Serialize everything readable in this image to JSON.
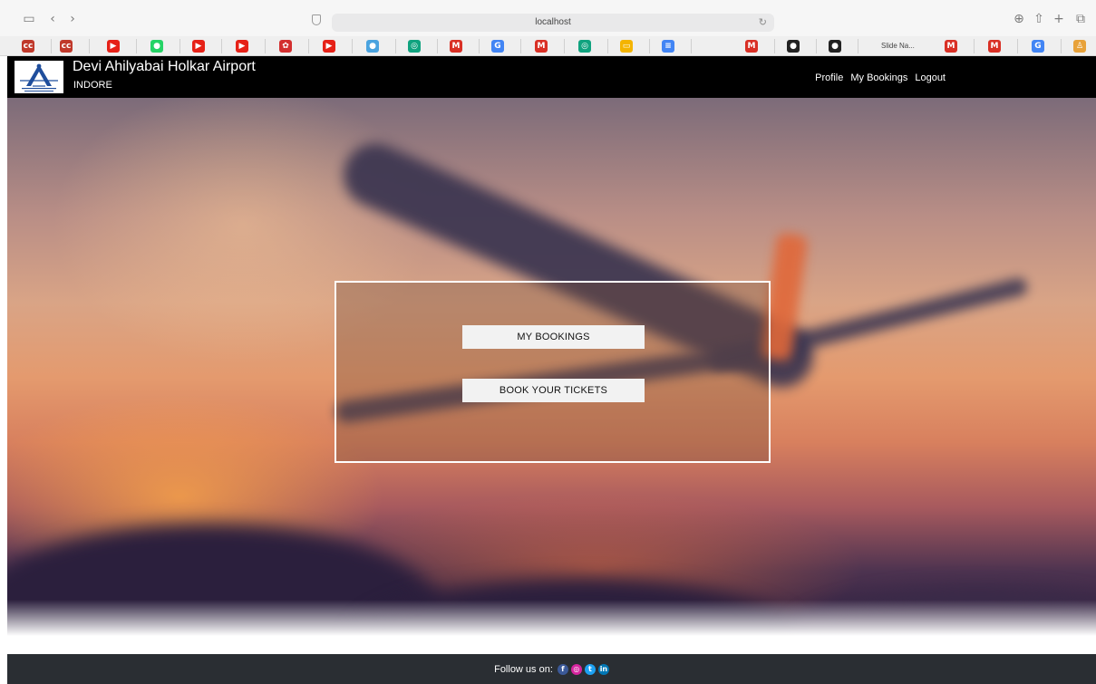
{
  "browser": {
    "url": "localhost",
    "bookmarks": [
      {
        "icon": "cc-icon",
        "glyph": "cc",
        "color": "#c0392b"
      },
      {
        "icon": "cc-icon",
        "glyph": "cc",
        "color": "#c0392b"
      },
      {
        "icon": "youtube-icon",
        "glyph": "▶",
        "color": "#e62117"
      },
      {
        "icon": "whatsapp-icon",
        "glyph": "●",
        "color": "#25d366"
      },
      {
        "icon": "youtube-icon",
        "glyph": "▶",
        "color": "#e62117"
      },
      {
        "icon": "youtube-icon",
        "glyph": "▶",
        "color": "#e62117"
      },
      {
        "icon": "gear-icon",
        "glyph": "✿",
        "color": "#d32f2f"
      },
      {
        "icon": "youtube-icon",
        "glyph": "▶",
        "color": "#e62117"
      },
      {
        "icon": "chrome-icon",
        "glyph": "●",
        "color": "#4aa3df"
      },
      {
        "icon": "chatgpt-icon",
        "glyph": "◎",
        "color": "#10a37f"
      },
      {
        "icon": "gmail-icon",
        "glyph": "M",
        "color": "#d93025"
      },
      {
        "icon": "google-icon",
        "glyph": "G",
        "color": "#4285f4"
      },
      {
        "icon": "gmail-icon",
        "glyph": "M",
        "color": "#d93025"
      },
      {
        "icon": "chatgpt-icon",
        "glyph": "◎",
        "color": "#10a37f"
      },
      {
        "icon": "slides-icon",
        "glyph": "▭",
        "color": "#f4b400"
      },
      {
        "icon": "docs-icon",
        "glyph": "≡",
        "color": "#4285f4"
      },
      {
        "icon": "gmail-icon",
        "glyph": "M",
        "color": "#d93025"
      },
      {
        "icon": "github-icon",
        "glyph": "●",
        "color": "#222222"
      },
      {
        "icon": "github-icon",
        "glyph": "●",
        "color": "#222222"
      },
      {
        "icon": "gmail-icon",
        "glyph": "M",
        "color": "#d93025"
      },
      {
        "icon": "gmail-icon",
        "glyph": "M",
        "color": "#d93025"
      },
      {
        "icon": "google-icon",
        "glyph": "G",
        "color": "#4285f4"
      },
      {
        "icon": "person-icon",
        "glyph": "♙",
        "color": "#e8a23a"
      }
    ],
    "bookmark_text": "Slide Na..."
  },
  "header": {
    "title": "Devi Ahilyabai Holkar Airport",
    "subtitle": "INDORE",
    "nav": [
      "Profile",
      "My Bookings",
      "Logout"
    ]
  },
  "panel": {
    "my_bookings": "MY BOOKINGS",
    "book_tickets": "BOOK YOUR TICKETS"
  },
  "footer": {
    "follow_label": "Follow us on:",
    "social": [
      {
        "icon": "facebook-icon",
        "glyph": "f",
        "color": "#3b5998"
      },
      {
        "icon": "instagram-icon",
        "glyph": "◎",
        "color": "#d6249f"
      },
      {
        "icon": "twitter-icon",
        "glyph": "t",
        "color": "#1da1f2"
      },
      {
        "icon": "linkedin-icon",
        "glyph": "in",
        "color": "#0077b5"
      }
    ]
  },
  "colors": {
    "navbar": "#000000",
    "footer": "#2a2e33",
    "button": "#f2f2f2"
  }
}
